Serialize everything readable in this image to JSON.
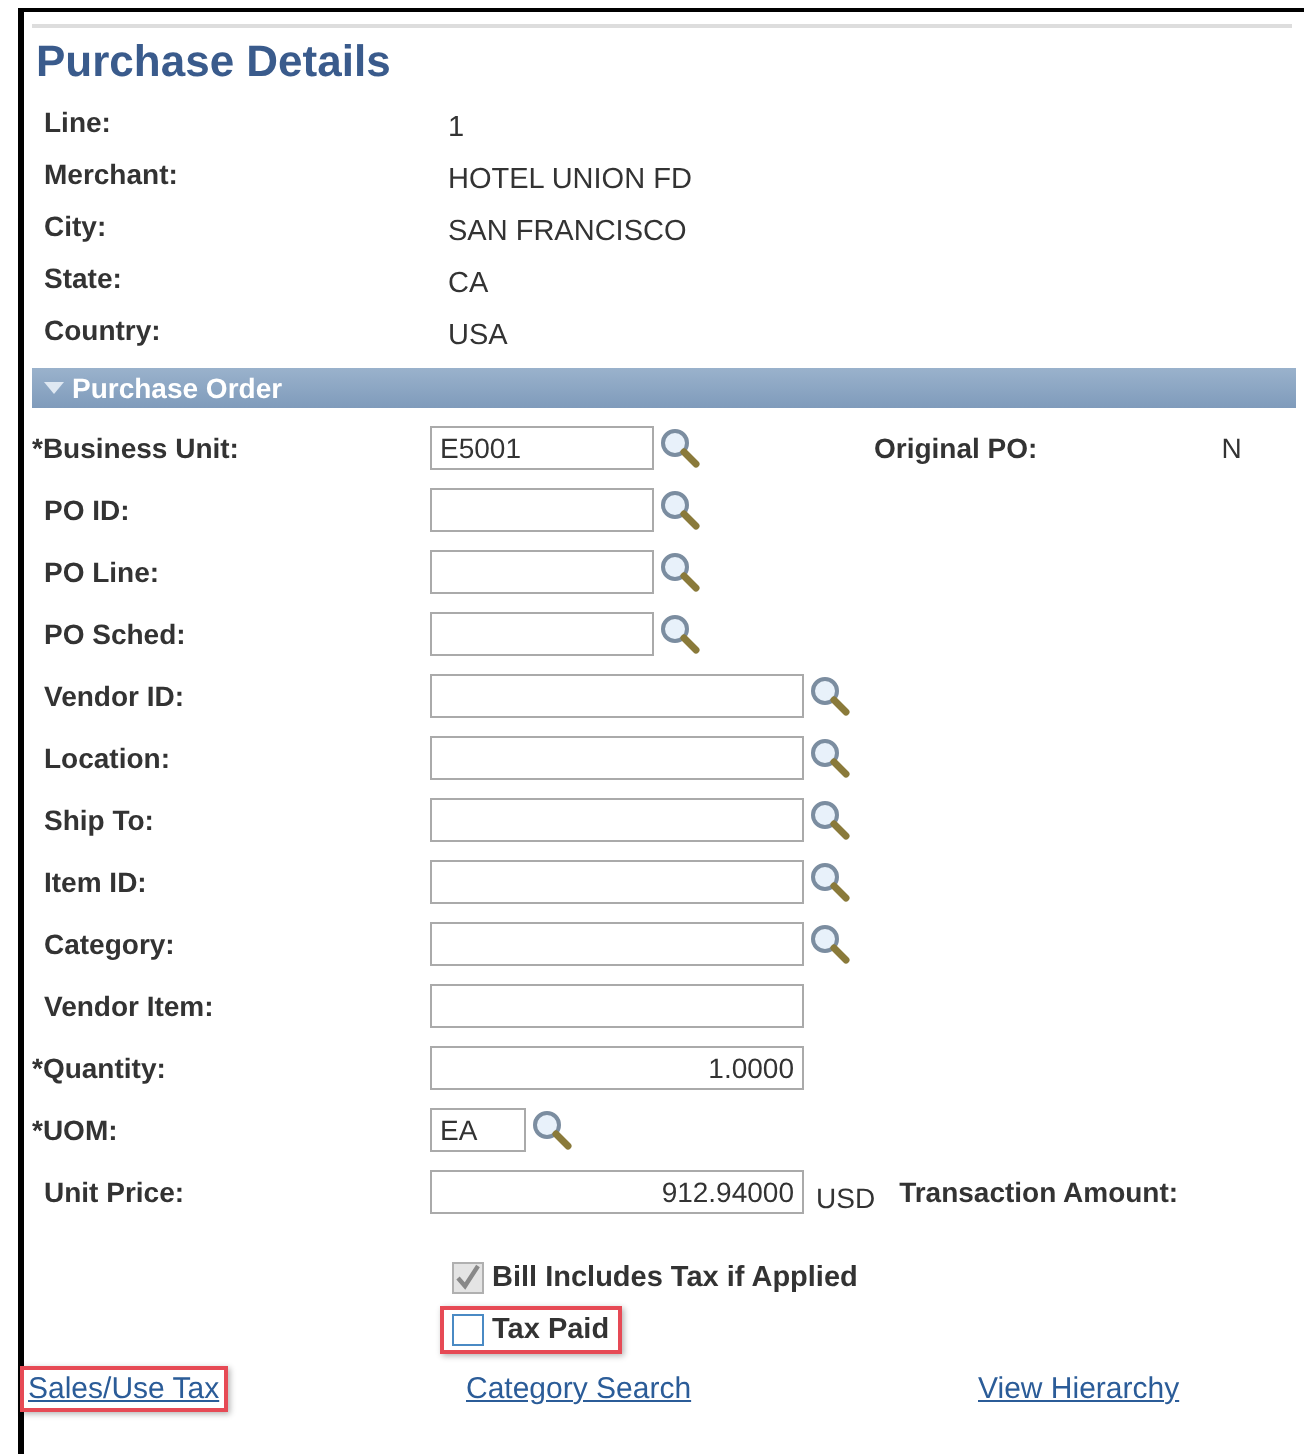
{
  "title": "Purchase Details",
  "details": [
    {
      "label": "Line:",
      "value": "1"
    },
    {
      "label": "Merchant:",
      "value": "HOTEL UNION FD"
    },
    {
      "label": "City:",
      "value": "SAN FRANCISCO"
    },
    {
      "label": "State:",
      "value": "CA"
    },
    {
      "label": "Country:",
      "value": "USA"
    }
  ],
  "section": {
    "title": "Purchase Order",
    "expanded": true
  },
  "fields": [
    {
      "label": "*Business Unit:",
      "value": "E5001",
      "kind": "short_lookup",
      "extra_label": "Original PO:",
      "extra_value": "N"
    },
    {
      "label": "PO ID:",
      "kind": "short_lookup"
    },
    {
      "label": "PO Line:",
      "kind": "short_lookup"
    },
    {
      "label": "PO Sched:",
      "kind": "short_lookup"
    },
    {
      "label": "Vendor ID:",
      "kind": "long_lookup"
    },
    {
      "label": "Location:",
      "kind": "long_lookup"
    },
    {
      "label": "Ship To:",
      "kind": "long_lookup"
    },
    {
      "label": "Item ID:",
      "kind": "long_lookup"
    },
    {
      "label": "Category:",
      "kind": "long_lookup"
    },
    {
      "label": "Vendor Item:",
      "kind": "text"
    },
    {
      "label": "*Quantity:",
      "value": "1.0000",
      "kind": "number"
    },
    {
      "label": "*UOM:",
      "value": "EA",
      "kind": "tiny_lookup"
    },
    {
      "label": "Unit Price:",
      "value": "912.94000",
      "kind": "number",
      "suffix": "USD",
      "extra_label": "Transaction Amount:"
    }
  ],
  "checkboxes": [
    {
      "label": "Bill Includes Tax if Applied",
      "checked": true,
      "disabled": true,
      "highlighted": false
    },
    {
      "label": "Tax Paid",
      "checked": false,
      "disabled": false,
      "highlighted": true
    }
  ],
  "links": [
    {
      "label": "Sales/Use Tax",
      "highlighted": true
    },
    {
      "label": "Category Search",
      "highlighted": false
    },
    {
      "label": "View Hierarchy",
      "highlighted": false
    }
  ]
}
